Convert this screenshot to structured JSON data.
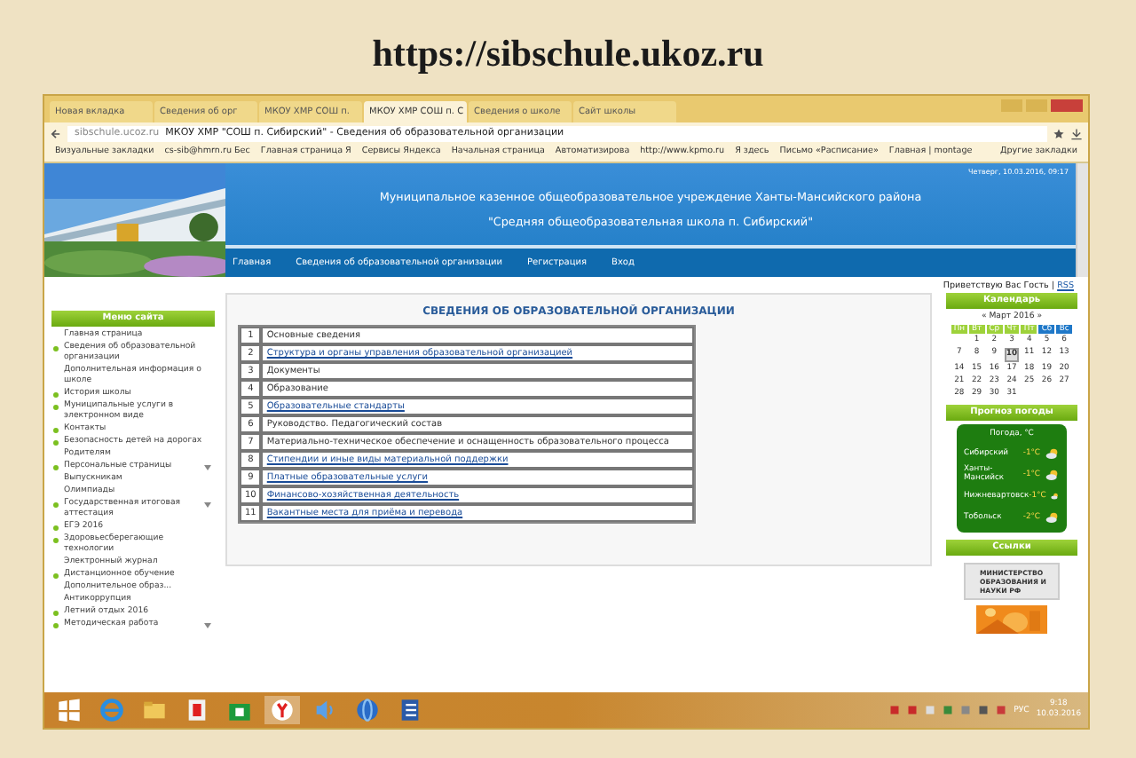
{
  "slide_title": "https://sibschule.ukoz.ru",
  "browser": {
    "tabs": [
      {
        "label": "Новая вкладка",
        "selected": false
      },
      {
        "label": "Сведения об орг",
        "selected": false
      },
      {
        "label": "МКОУ ХМР СОШ п.",
        "selected": false
      },
      {
        "label": "МКОУ ХМР СОШ п. С",
        "selected": true
      },
      {
        "label": "Сведения о школе",
        "selected": false
      },
      {
        "label": "Сайт школы",
        "selected": false
      }
    ],
    "address": {
      "url": "sibschule.ucoz.ru",
      "page_title": "МКОУ ХМР \"СОШ п. Сибирский\" - Сведения об образовательной организации"
    },
    "bookmarks": [
      "Визуальные закладки",
      "cs-sib@hmrn.ru Бес",
      "Главная страница Я",
      "Сервисы Яндекса",
      "Начальная страница",
      "Автоматизирова",
      "http://www.kpmo.ru",
      "Я здесь",
      "Письмо «Расписание»",
      "Главная | montage"
    ],
    "other_bookmarks": "Другие закладки"
  },
  "site": {
    "date": "Четверг, 10.03.2016, 09:17",
    "header_lines": [
      "Муниципальное казенное общеобразовательное учреждение Ханты-Мансийского района",
      "\"Средняя общеобразовательная школа п. Сибирский\""
    ],
    "nav": [
      "Главная",
      "Сведения об образовательной организации",
      "Регистрация",
      "Вход"
    ],
    "greeting": "Приветствую Вас Гость",
    "separator": "|",
    "rss": "RSS",
    "menu": {
      "title": "Меню сайта",
      "items": [
        {
          "label": "Главная страница",
          "bullet": false,
          "submenu": false
        },
        {
          "label": "Сведения об образовательной организации",
          "bullet": true,
          "submenu": false
        },
        {
          "label": "Дополнительная информация о школе",
          "bullet": false,
          "submenu": false
        },
        {
          "label": "История школы",
          "bullet": true,
          "submenu": false
        },
        {
          "label": "Муниципальные услуги в электронном виде",
          "bullet": true,
          "submenu": false
        },
        {
          "label": "Контакты",
          "bullet": true,
          "submenu": false
        },
        {
          "label": "Безопасность детей на дорогах",
          "bullet": true,
          "submenu": false
        },
        {
          "label": "Родителям",
          "bullet": false,
          "submenu": false
        },
        {
          "label": "Персональные страницы",
          "bullet": true,
          "submenu": true
        },
        {
          "label": "Выпускникам",
          "bullet": false,
          "submenu": false
        },
        {
          "label": "Олимпиады",
          "bullet": false,
          "submenu": false
        },
        {
          "label": "Государственная итоговая аттестация",
          "bullet": true,
          "submenu": true
        },
        {
          "label": "ЕГЭ 2016",
          "bullet": true,
          "submenu": false
        },
        {
          "label": "Здоровьесберегающие технологии",
          "bullet": true,
          "submenu": false
        },
        {
          "label": "Электронный журнал",
          "bullet": false,
          "submenu": false
        },
        {
          "label": "Дистанционное обучение",
          "bullet": true,
          "submenu": false
        },
        {
          "label": "Дополнительное образ...",
          "bullet": false,
          "submenu": false
        },
        {
          "label": "Антикоррупция",
          "bullet": false,
          "submenu": false
        },
        {
          "label": "Летний отдых 2016",
          "bullet": true,
          "submenu": false
        },
        {
          "label": "Методическая работа",
          "bullet": true,
          "submenu": true
        }
      ]
    },
    "main": {
      "title": "СВЕДЕНИЯ ОБ ОБРАЗОВАТЕЛЬНОЙ ОРГАНИЗАЦИИ",
      "rows": [
        {
          "number": "1",
          "label": "Основные сведения",
          "link": false
        },
        {
          "number": "2",
          "label": "Структура и органы управления образовательной организацией",
          "link": true
        },
        {
          "number": "3",
          "label": "Документы",
          "link": false
        },
        {
          "number": "4",
          "label": "Образование",
          "link": false
        },
        {
          "number": "5",
          "label": "Образовательные стандарты",
          "link": true
        },
        {
          "number": "6",
          "label": "Руководство. Педагогический состав",
          "link": false
        },
        {
          "number": "7",
          "label": "Материально-техническое обеспечение и оснащенность образовательного процесса",
          "link": false
        },
        {
          "number": "8",
          "label": "Стипендии и иные виды материальной поддержки",
          "link": true
        },
        {
          "number": "9",
          "label": "Платные образовательные услуги",
          "link": true
        },
        {
          "number": "10",
          "label": "Финансово-хозяйственная деятельность",
          "link": true
        },
        {
          "number": "11",
          "label": "Вакантные места для приёма и перевода",
          "link": true
        }
      ]
    },
    "calendar": {
      "title": "Календарь",
      "month": "« Март 2016 »",
      "weekdays": [
        "Пн",
        "Вт",
        "Ср",
        "Чт",
        "Пт",
        "Сб",
        "Вс"
      ],
      "weeks": [
        [
          {
            "day": "1",
            "selected": false
          },
          {
            "day": "2",
            "selected": false
          },
          {
            "day": "3",
            "selected": false
          },
          {
            "day": "4",
            "selected": false
          },
          {
            "day": "5",
            "selected": false
          },
          {
            "day": "6",
            "selected": false
          }
        ],
        [
          {
            "day": "7",
            "selected": false
          },
          {
            "day": "8",
            "selected": false
          },
          {
            "day": "9",
            "selected": false
          },
          {
            "day": "10",
            "selected": true
          },
          {
            "day": "11",
            "selected": false
          },
          {
            "day": "12",
            "selected": false
          },
          {
            "day": "13",
            "selected": false
          }
        ],
        [
          {
            "day": "14",
            "selected": false
          },
          {
            "day": "15",
            "selected": false
          },
          {
            "day": "16",
            "selected": false
          },
          {
            "day": "17",
            "selected": false
          },
          {
            "day": "18",
            "selected": false
          },
          {
            "day": "19",
            "selected": false
          },
          {
            "day": "20",
            "selected": false
          }
        ],
        [
          {
            "day": "21",
            "selected": false
          },
          {
            "day": "22",
            "selected": false
          },
          {
            "day": "23",
            "selected": false
          },
          {
            "day": "24",
            "selected": false
          },
          {
            "day": "25",
            "selected": false
          },
          {
            "day": "26",
            "selected": false
          },
          {
            "day": "27",
            "selected": false
          }
        ],
        [
          {
            "day": "28",
            "selected": false
          },
          {
            "day": "29",
            "selected": false
          },
          {
            "day": "30",
            "selected": false
          },
          {
            "day": "31",
            "selected": false
          }
        ]
      ]
    },
    "weather": {
      "title": "Прогноз погоды",
      "heading": "Погода, °C",
      "rows": [
        {
          "town": "Сибирский",
          "temp": "-1°C"
        },
        {
          "town": "Ханты-Мансийск",
          "temp": "-1°C"
        },
        {
          "town": "Нижневартовск",
          "temp": "-1°C"
        },
        {
          "town": "Тобольск",
          "temp": "-2°C"
        }
      ]
    },
    "links": {
      "title": "Ссылки",
      "banner": "МИНИСТЕРСТВО ОБРАЗОВАНИЯ И НАУКИ РФ"
    }
  },
  "taskbar": {
    "language": "РУС",
    "time": "9:18",
    "date": "10.03.2016"
  }
}
